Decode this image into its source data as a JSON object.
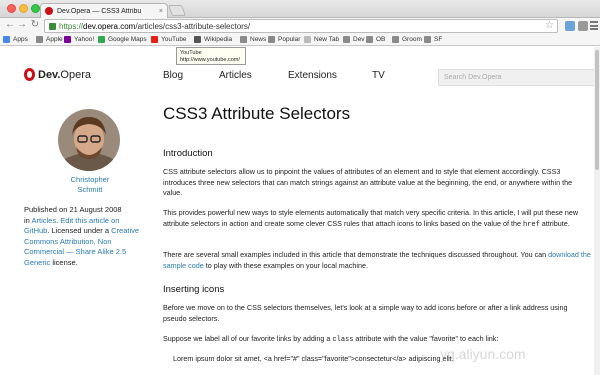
{
  "browser": {
    "tab_title": "Dev.Opera — CSS3 Attribu",
    "tab_close": "×",
    "back": "←",
    "forward": "→",
    "reload": "↻",
    "url_scheme": "https://",
    "url_host": "dev.opera.com",
    "url_path": "/articles/css3-attribute-selectors/",
    "star": "☆",
    "bookmarks": [
      {
        "label": "Apps",
        "icon": "apps-icon",
        "color": "#4a86e8"
      },
      {
        "label": "Apple",
        "icon": "apple-icon",
        "color": "#888888"
      },
      {
        "label": "Yahoo!",
        "icon": "yahoo-icon",
        "color": "#7b0099"
      },
      {
        "label": "Google Maps",
        "icon": "maps-icon",
        "color": "#34a853"
      },
      {
        "label": "YouTube",
        "icon": "youtube-icon",
        "color": "#e62117"
      },
      {
        "label": "Wikipedia",
        "icon": "wikipedia-icon",
        "color": "#555555"
      },
      {
        "label": "News",
        "icon": "folder-icon",
        "color": "#8a8a8a"
      },
      {
        "label": "Popular",
        "icon": "folder-icon",
        "color": "#8a8a8a"
      },
      {
        "label": "New Tab",
        "icon": "page-icon",
        "color": "#bbbbbb"
      },
      {
        "label": "Dev",
        "icon": "folder-icon",
        "color": "#8a8a8a"
      },
      {
        "label": "OB",
        "icon": "folder-icon",
        "color": "#8a8a8a"
      },
      {
        "label": "Groom",
        "icon": "folder-icon",
        "color": "#8a8a8a"
      },
      {
        "label": "SF",
        "icon": "folder-icon",
        "color": "#8a8a8a"
      }
    ],
    "tooltip_title": "YouTube",
    "tooltip_url": "http://www.youtube.com/"
  },
  "site": {
    "logo_dev": "Dev.",
    "logo_opera": "Opera",
    "nav": [
      "Blog",
      "Articles",
      "Extensions",
      "TV"
    ],
    "search_placeholder": "Search Dev.Opera",
    "brand_color": "#cc0f16",
    "link_color": "#2a7ab8"
  },
  "sidebar": {
    "author_first": "Christopher",
    "author_last": "Schmitt",
    "published": "Published on 21 August 2008",
    "in": "in ",
    "category": "Articles",
    "period": ". ",
    "edit_link": "Edit this article on GitHub",
    "licensed": ". Licensed under a ",
    "license_link": "Creative Commons Attribution, Non Commercial — Share Alike 2.5 Generic",
    "license_end": " license."
  },
  "article": {
    "title": "CSS3 Attribute Selectors",
    "intro_heading": "Introduction",
    "p1": "CSS attribute selectors allow us to pinpoint the values of attributes of an element and to style that element accordingly. CSS3 introduces three new selectors that can match strings against an attribute value at the beginning, the end, or anywhere within the value.",
    "p2_a": "This provides powerful new ways to style elements automatically that match very specific criteria. In this article, I will put these new attribute selectors in action and create some clever CSS rules that attach icons to links based on the value of the ",
    "p2_code": "href",
    "p2_b": " attribute.",
    "p3_a": "There are several small examples included in this article that demonstrate the techniques discussed throughout. You can ",
    "p3_link": "download the sample code",
    "p3_b": " to play with these examples on your local machine.",
    "inserting_heading": "Inserting icons",
    "p4": "Before we move on to the CSS selectors themselves, let's look at a simple way to add icons before or after a link address using pseudo selectors.",
    "p5_a": "Suppose we label all of our favorite links by adding a ",
    "p5_code": "class",
    "p5_b": " attribute with the value \"favorite\" to each link:",
    "p6": "Lorem ipsum dolor sit amet, <a href=\"#\" class=\"favorite\">consectetur</a> adipiscing elit."
  },
  "watermark": "yq.aliyun.com"
}
